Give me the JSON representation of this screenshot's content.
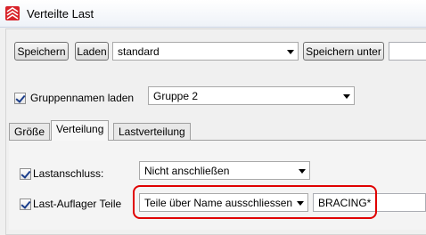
{
  "window": {
    "title": "Verteilte Last",
    "icon": "red-white-app-icon"
  },
  "toolbar": {
    "save_label": "Speichern",
    "load_label": "Laden",
    "preset_value": "standard",
    "save_as_label": "Speichern unter",
    "save_as_name_value": ""
  },
  "group": {
    "checkbox_label": "Gruppennamen laden",
    "checked": true,
    "select_value": "Gruppe 2"
  },
  "tabs": [
    {
      "label": "Größe",
      "active": false
    },
    {
      "label": "Verteilung",
      "active": true
    },
    {
      "label": "Lastverteilung",
      "active": false
    }
  ],
  "distribution": {
    "load_connection": {
      "label": "Lastanschluss:",
      "checked": true,
      "select_value": "Nicht anschließen"
    },
    "load_support": {
      "label": "Last-Auflager Teile",
      "checked": true,
      "select_value": "Teile über Name ausschliessen",
      "filter_value": "BRACING*"
    }
  },
  "colors": {
    "highlight": "#e00000",
    "check": "#1a3d8a"
  }
}
